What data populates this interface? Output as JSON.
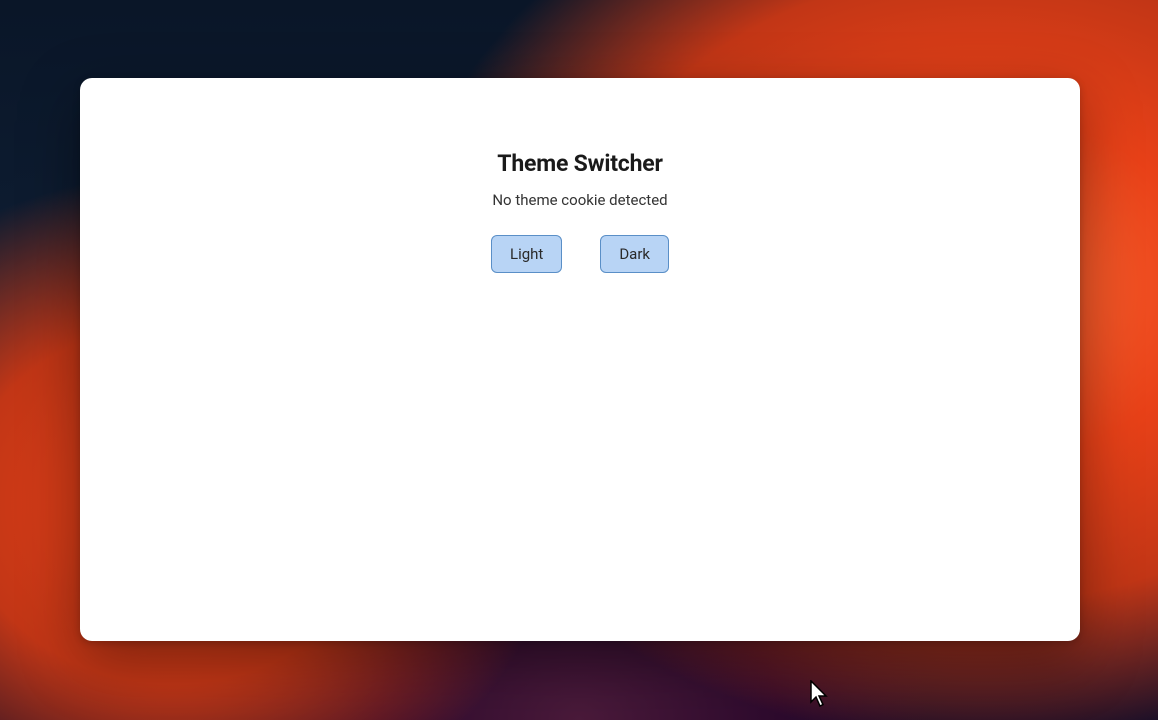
{
  "main": {
    "heading": "Theme Switcher",
    "status_message": "No theme cookie detected",
    "buttons": {
      "light_label": "Light",
      "dark_label": "Dark"
    }
  }
}
